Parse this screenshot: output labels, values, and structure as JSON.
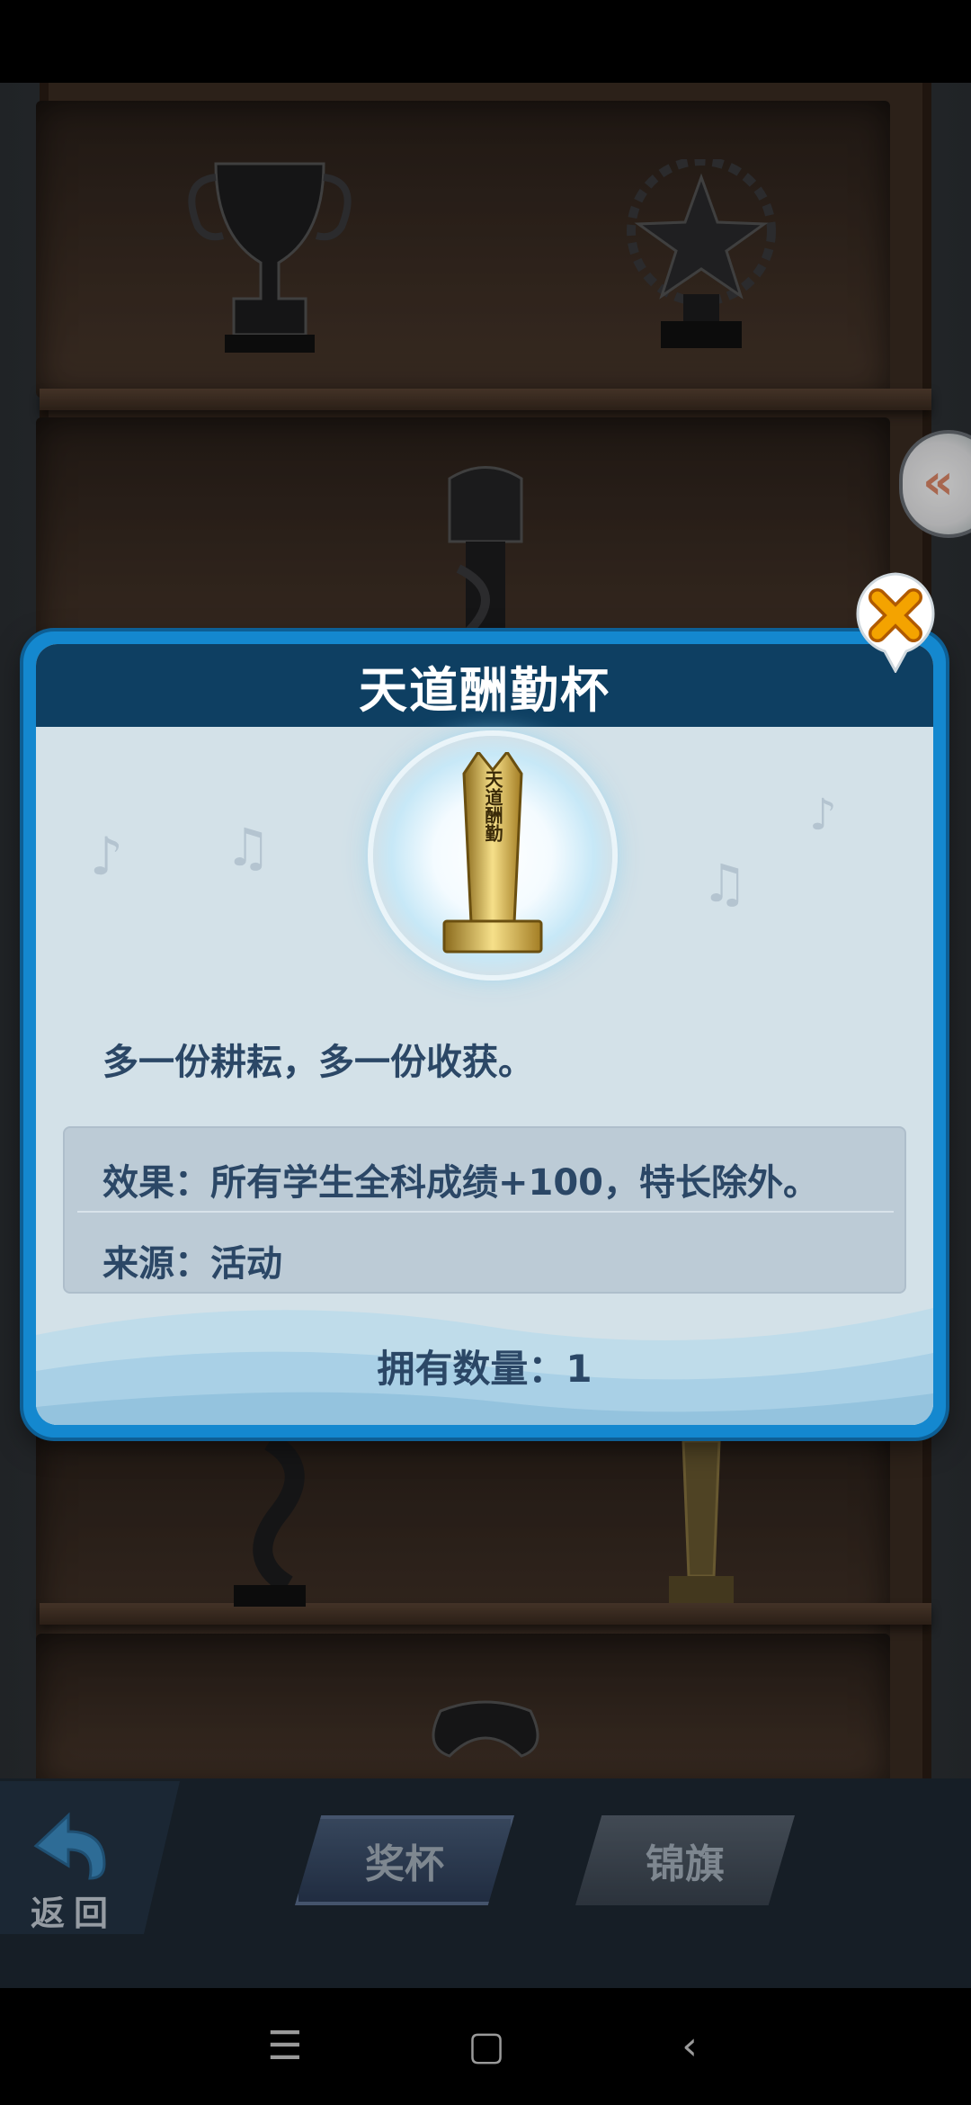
{
  "dialog": {
    "title": "天道酬勤杯",
    "motto": "多一份耕耘，多一份收获。",
    "effect": "效果：所有学生全科成绩+100，特长除外。",
    "source": "来源：活动",
    "owned": "拥有数量：1",
    "trophy_engraving": "天道酬勤"
  },
  "bottom_bar": {
    "back_label": "返回",
    "tabs": [
      {
        "label": "奖杯",
        "active": true
      },
      {
        "label": "锦旗",
        "active": false
      }
    ]
  },
  "side_toggle": {
    "glyph": "«"
  },
  "nav": {
    "menu": "☰",
    "home": "▢",
    "back": "‹"
  },
  "colors": {
    "dialog_frame": "#1488cf",
    "dialog_header": "#0e3f62",
    "dialog_body": "#d3e1e8",
    "text_primary": "#2b4766",
    "close_button": "#f4a300"
  }
}
